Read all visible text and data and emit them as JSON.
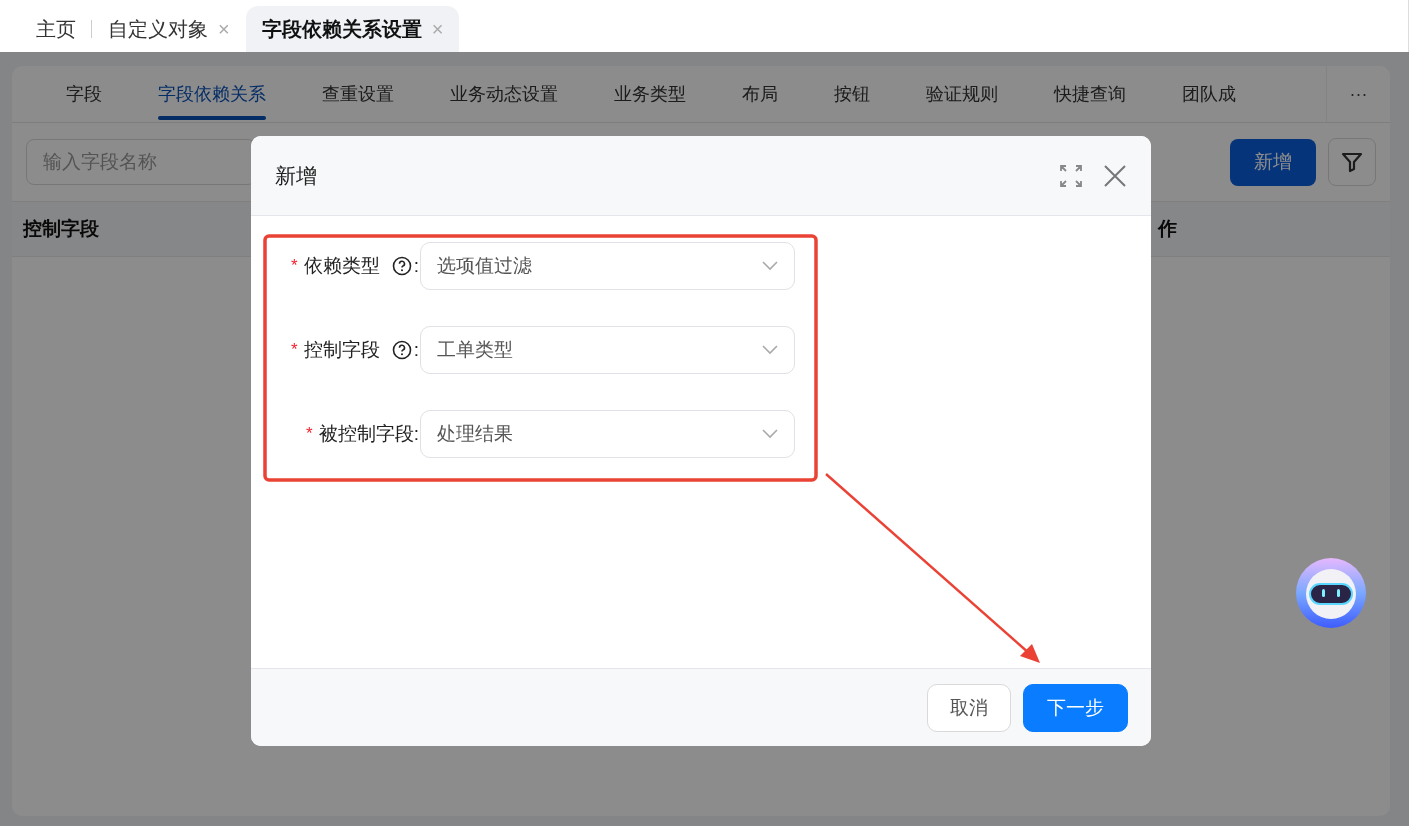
{
  "top_tabs": [
    {
      "label": "主页",
      "selected": false
    },
    {
      "label": "自定义对象",
      "selected": false,
      "close": "×"
    },
    {
      "label": "字段依赖关系设置",
      "selected": true,
      "close": "×"
    }
  ],
  "sub_tabs": [
    {
      "label": "字段",
      "selected": false
    },
    {
      "label": "字段依赖关系",
      "selected": true
    },
    {
      "label": "查重设置",
      "selected": false
    },
    {
      "label": "业务动态设置",
      "selected": false
    },
    {
      "label": "业务类型",
      "selected": false
    },
    {
      "label": "布局",
      "selected": false
    },
    {
      "label": "按钮",
      "selected": false
    },
    {
      "label": "验证规则",
      "selected": false
    },
    {
      "label": "快捷查询",
      "selected": false
    },
    {
      "label": "团队成",
      "selected": false
    }
  ],
  "more": "···",
  "search": {
    "placeholder": "输入字段名称"
  },
  "new_button": "新增",
  "table": {
    "columns": [
      "控制字段",
      "作"
    ]
  },
  "dialog": {
    "title": "新增",
    "fields": [
      {
        "required_mark": "*",
        "label": "依赖类型",
        "help": true,
        "colon": ":",
        "value": "选项值过滤"
      },
      {
        "required_mark": "*",
        "label": "控制字段",
        "help": true,
        "colon": ":",
        "value": "工单类型"
      },
      {
        "required_mark": "*",
        "label": "被控制字段",
        "help": false,
        "colon": ":",
        "value": "处理结果"
      }
    ],
    "buttons": [
      {
        "label": "取消",
        "kind": "secondary"
      },
      {
        "label": "下一步",
        "kind": "primary"
      }
    ]
  }
}
